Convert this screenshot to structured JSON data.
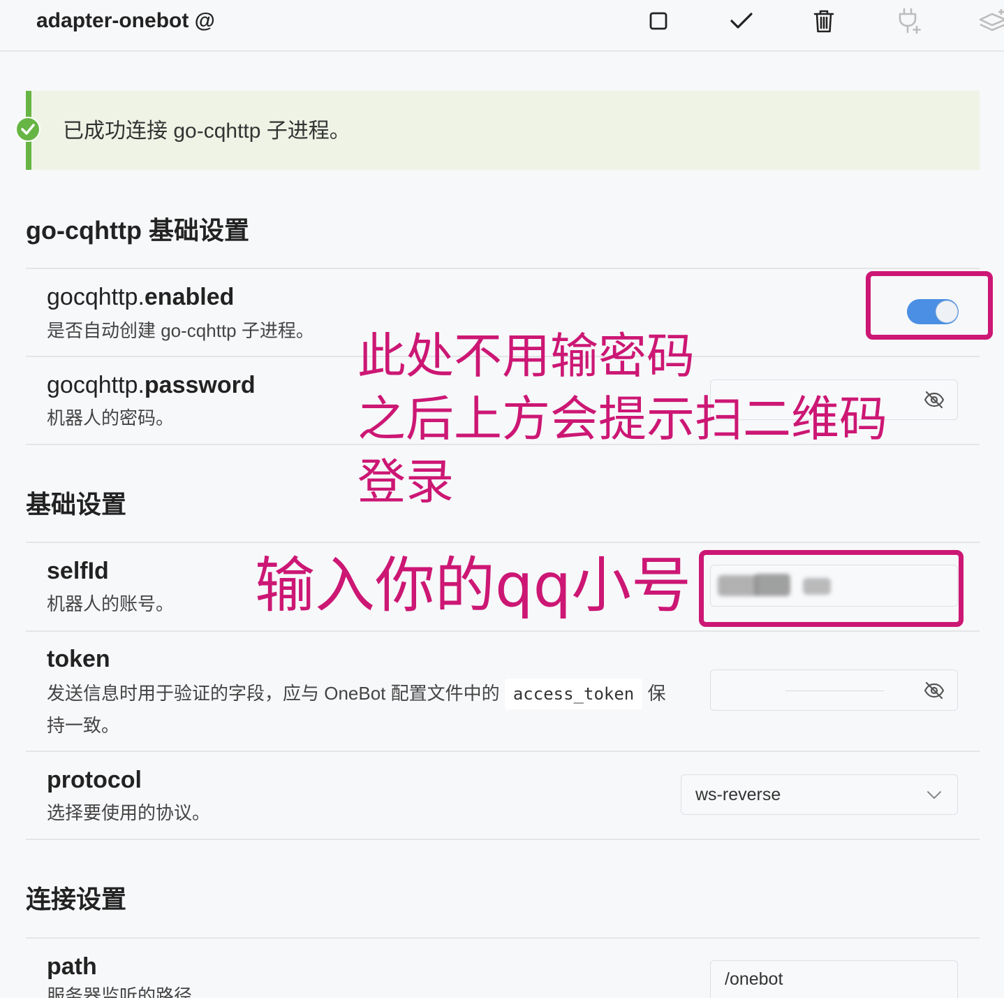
{
  "header": {
    "title": "adapter-onebot @",
    "toolbar": [
      {
        "icon": "stop-icon",
        "disabled": false
      },
      {
        "icon": "check-icon",
        "disabled": false
      },
      {
        "icon": "trash-icon",
        "disabled": false
      },
      {
        "icon": "plug-icon",
        "disabled": true
      },
      {
        "icon": "layers-icon",
        "disabled": true
      }
    ]
  },
  "alert": {
    "icon": "check-circle-icon",
    "message": "已成功连接 go-cqhttp 子进程。"
  },
  "sections": [
    {
      "title": "go-cqhttp 基础设置",
      "items": [
        {
          "key_prefix": "gocqhttp.",
          "key_name": "enabled",
          "description": "是否自动创建 go-cqhttp 子进程。",
          "value": true
        },
        {
          "key_prefix": "gocqhttp.",
          "key_name": "password",
          "description": "机器人的密码。",
          "icon": "eye-off-icon"
        }
      ]
    },
    {
      "title": "基础设置",
      "items": [
        {
          "key_name": "selfId",
          "description": "机器人的账号。"
        },
        {
          "key_name": "token",
          "description_before": "发送信息时用于验证的字段，应与 OneBot 配置文件中的",
          "description_code": "access_token",
          "description_after": "保持一致。",
          "icon": "eye-off-icon"
        },
        {
          "key_name": "protocol",
          "description": "选择要使用的协议。",
          "value": "ws-reverse",
          "icon": "chevron-down-icon"
        }
      ]
    },
    {
      "title": "连接设置",
      "items": [
        {
          "key_name": "path",
          "description": "服务器监听的路径",
          "value": "/onebot"
        }
      ]
    }
  ],
  "annotations": {
    "password_note": [
      "此处不用输密码",
      "之后上方会提示扫二维码",
      "登录"
    ],
    "selfid_note": "输入你的qq小号"
  },
  "colors": {
    "page_bg": "#f7f8fa",
    "accent": "#4a8fe3",
    "success": "#67b545",
    "alert_bg": "#eef3e5",
    "annotation": "#cc1774"
  }
}
